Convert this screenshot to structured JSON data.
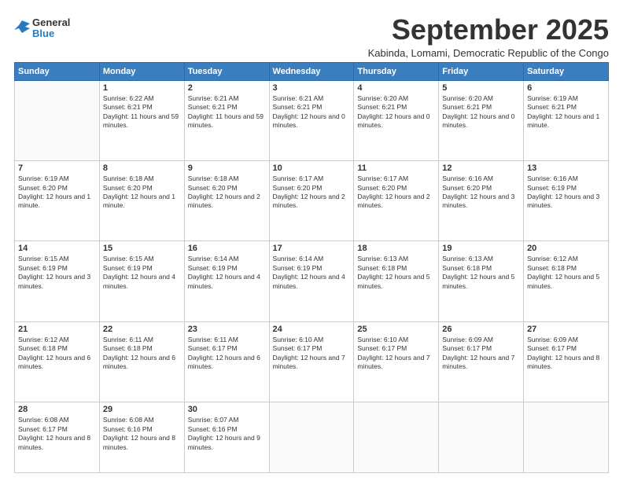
{
  "header": {
    "logo": {
      "general": "General",
      "blue": "Blue"
    },
    "title": "September 2025",
    "subtitle": "Kabinda, Lomami, Democratic Republic of the Congo"
  },
  "days_of_week": [
    "Sunday",
    "Monday",
    "Tuesday",
    "Wednesday",
    "Thursday",
    "Friday",
    "Saturday"
  ],
  "weeks": [
    [
      {
        "num": "",
        "info": ""
      },
      {
        "num": "1",
        "info": "Sunrise: 6:22 AM\nSunset: 6:21 PM\nDaylight: 11 hours and 59 minutes."
      },
      {
        "num": "2",
        "info": "Sunrise: 6:21 AM\nSunset: 6:21 PM\nDaylight: 11 hours and 59 minutes."
      },
      {
        "num": "3",
        "info": "Sunrise: 6:21 AM\nSunset: 6:21 PM\nDaylight: 12 hours and 0 minutes."
      },
      {
        "num": "4",
        "info": "Sunrise: 6:20 AM\nSunset: 6:21 PM\nDaylight: 12 hours and 0 minutes."
      },
      {
        "num": "5",
        "info": "Sunrise: 6:20 AM\nSunset: 6:21 PM\nDaylight: 12 hours and 0 minutes."
      },
      {
        "num": "6",
        "info": "Sunrise: 6:19 AM\nSunset: 6:21 PM\nDaylight: 12 hours and 1 minute."
      }
    ],
    [
      {
        "num": "7",
        "info": "Sunrise: 6:19 AM\nSunset: 6:20 PM\nDaylight: 12 hours and 1 minute."
      },
      {
        "num": "8",
        "info": "Sunrise: 6:18 AM\nSunset: 6:20 PM\nDaylight: 12 hours and 1 minute."
      },
      {
        "num": "9",
        "info": "Sunrise: 6:18 AM\nSunset: 6:20 PM\nDaylight: 12 hours and 2 minutes."
      },
      {
        "num": "10",
        "info": "Sunrise: 6:17 AM\nSunset: 6:20 PM\nDaylight: 12 hours and 2 minutes."
      },
      {
        "num": "11",
        "info": "Sunrise: 6:17 AM\nSunset: 6:20 PM\nDaylight: 12 hours and 2 minutes."
      },
      {
        "num": "12",
        "info": "Sunrise: 6:16 AM\nSunset: 6:20 PM\nDaylight: 12 hours and 3 minutes."
      },
      {
        "num": "13",
        "info": "Sunrise: 6:16 AM\nSunset: 6:19 PM\nDaylight: 12 hours and 3 minutes."
      }
    ],
    [
      {
        "num": "14",
        "info": "Sunrise: 6:15 AM\nSunset: 6:19 PM\nDaylight: 12 hours and 3 minutes."
      },
      {
        "num": "15",
        "info": "Sunrise: 6:15 AM\nSunset: 6:19 PM\nDaylight: 12 hours and 4 minutes."
      },
      {
        "num": "16",
        "info": "Sunrise: 6:14 AM\nSunset: 6:19 PM\nDaylight: 12 hours and 4 minutes."
      },
      {
        "num": "17",
        "info": "Sunrise: 6:14 AM\nSunset: 6:19 PM\nDaylight: 12 hours and 4 minutes."
      },
      {
        "num": "18",
        "info": "Sunrise: 6:13 AM\nSunset: 6:18 PM\nDaylight: 12 hours and 5 minutes."
      },
      {
        "num": "19",
        "info": "Sunrise: 6:13 AM\nSunset: 6:18 PM\nDaylight: 12 hours and 5 minutes."
      },
      {
        "num": "20",
        "info": "Sunrise: 6:12 AM\nSunset: 6:18 PM\nDaylight: 12 hours and 5 minutes."
      }
    ],
    [
      {
        "num": "21",
        "info": "Sunrise: 6:12 AM\nSunset: 6:18 PM\nDaylight: 12 hours and 6 minutes."
      },
      {
        "num": "22",
        "info": "Sunrise: 6:11 AM\nSunset: 6:18 PM\nDaylight: 12 hours and 6 minutes."
      },
      {
        "num": "23",
        "info": "Sunrise: 6:11 AM\nSunset: 6:17 PM\nDaylight: 12 hours and 6 minutes."
      },
      {
        "num": "24",
        "info": "Sunrise: 6:10 AM\nSunset: 6:17 PM\nDaylight: 12 hours and 7 minutes."
      },
      {
        "num": "25",
        "info": "Sunrise: 6:10 AM\nSunset: 6:17 PM\nDaylight: 12 hours and 7 minutes."
      },
      {
        "num": "26",
        "info": "Sunrise: 6:09 AM\nSunset: 6:17 PM\nDaylight: 12 hours and 7 minutes."
      },
      {
        "num": "27",
        "info": "Sunrise: 6:09 AM\nSunset: 6:17 PM\nDaylight: 12 hours and 8 minutes."
      }
    ],
    [
      {
        "num": "28",
        "info": "Sunrise: 6:08 AM\nSunset: 6:17 PM\nDaylight: 12 hours and 8 minutes."
      },
      {
        "num": "29",
        "info": "Sunrise: 6:08 AM\nSunset: 6:16 PM\nDaylight: 12 hours and 8 minutes."
      },
      {
        "num": "30",
        "info": "Sunrise: 6:07 AM\nSunset: 6:16 PM\nDaylight: 12 hours and 9 minutes."
      },
      {
        "num": "",
        "info": ""
      },
      {
        "num": "",
        "info": ""
      },
      {
        "num": "",
        "info": ""
      },
      {
        "num": "",
        "info": ""
      }
    ]
  ]
}
